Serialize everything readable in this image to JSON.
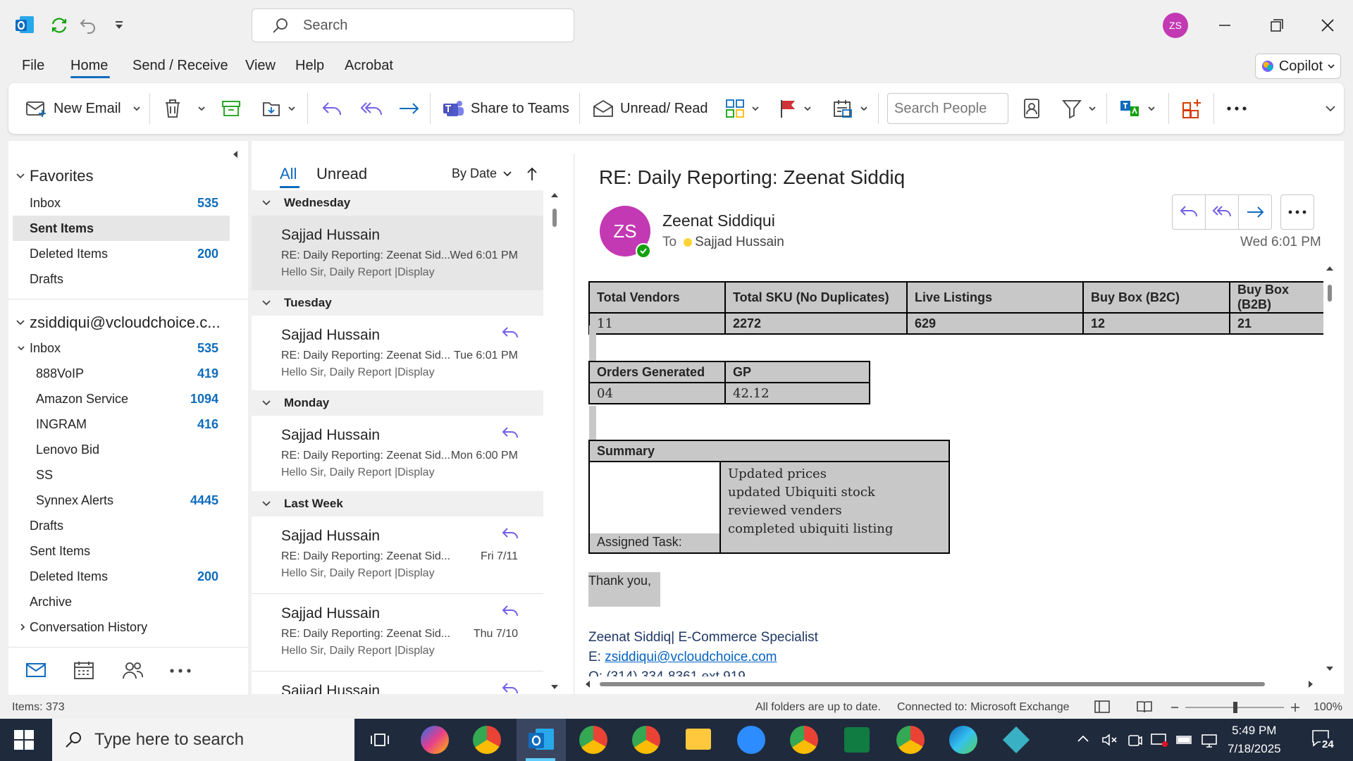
{
  "app": {
    "search_placeholder": "Search",
    "user_initials": "ZS"
  },
  "menu": [
    "File",
    "Home",
    "Send / Receive",
    "View",
    "Help",
    "Acrobat"
  ],
  "copilot_label": "Copilot",
  "ribbon": {
    "new_email": "New Email",
    "share_teams": "Share to Teams",
    "unread_read": "Unread/ Read",
    "search_people_placeholder": "Search People"
  },
  "folders": {
    "favorites_label": "Favorites",
    "favorites": [
      {
        "label": "Inbox",
        "count": "535"
      },
      {
        "label": "Sent Items",
        "count": ""
      },
      {
        "label": "Deleted Items",
        "count": "200"
      },
      {
        "label": "Drafts",
        "count": ""
      }
    ],
    "account_label": "zsiddiqui@vcloudchoice.c...",
    "inbox": {
      "label": "Inbox",
      "count": "535"
    },
    "inbox_children": [
      {
        "label": "888VoIP",
        "count": "419"
      },
      {
        "label": "Amazon Service",
        "count": "1094"
      },
      {
        "label": "INGRAM",
        "count": "416"
      },
      {
        "label": "Lenovo Bid",
        "count": ""
      },
      {
        "label": "SS",
        "count": ""
      },
      {
        "label": "Synnex Alerts",
        "count": "4445"
      }
    ],
    "account_other": [
      {
        "label": "Drafts",
        "count": ""
      },
      {
        "label": "Sent Items",
        "count": ""
      },
      {
        "label": "Deleted Items",
        "count": "200"
      },
      {
        "label": "Archive",
        "count": ""
      }
    ],
    "conversation_history": "Conversation History"
  },
  "list": {
    "tab_all": "All",
    "tab_unread": "Unread",
    "sort": "By Date",
    "groups": [
      "Wednesday",
      "Tuesday",
      "Monday",
      "Last Week"
    ],
    "messages": [
      {
        "from": "Sajjad Hussain",
        "subject": "RE: Daily Reporting: Zeenat Sid...",
        "preview": "Hello Sir,  Daily Report |Display",
        "date": "Wed 6:01 PM"
      },
      {
        "from": "Sajjad Hussain",
        "subject": "RE: Daily Reporting: Zeenat Sid...",
        "preview": "Hello Sir,  Daily Report |Display",
        "date": "Tue 6:01 PM"
      },
      {
        "from": "Sajjad Hussain",
        "subject": "RE: Daily Reporting: Zeenat Sid...",
        "preview": "Hello Sir,  Daily Report |Display",
        "date": "Mon 6:00 PM"
      },
      {
        "from": "Sajjad Hussain",
        "subject": "RE: Daily Reporting: Zeenat Sid...",
        "preview": "Hello Sir,  Daily Report |Display",
        "date": "Fri 7/11"
      },
      {
        "from": "Sajjad Hussain",
        "subject": "RE: Daily Reporting: Zeenat Sid...",
        "preview": "Hello Sir,  Daily Report |Display",
        "date": "Thu 7/10"
      },
      {
        "from": "Sajjad Hussain",
        "subject": "",
        "preview": "",
        "date": ""
      }
    ]
  },
  "reading": {
    "subject": "RE: Daily Reporting: Zeenat Siddiq",
    "avatar": "ZS",
    "sender": "Zeenat Siddiqui",
    "to_label": "To",
    "to_name": "Sajjad Hussain",
    "date": "Wed 6:01 PM",
    "table1": {
      "headers": [
        "Total Vendors",
        "Total SKU (No Duplicates)",
        "Live Listings",
        "Buy Box (B2C)",
        "Buy Box (B2B)"
      ],
      "values": [
        "11",
        "2272",
        "629",
        "12",
        "21"
      ]
    },
    "table2": {
      "headers": [
        "Orders Generated",
        "GP"
      ],
      "values": [
        "04",
        "42.12"
      ]
    },
    "summary": {
      "title": "Summary",
      "label": "Assigned Task:",
      "items": [
        "Updated prices",
        "updated Ubiquiti stock",
        "reviewed venders",
        "completed ubiquiti listing"
      ]
    },
    "thanks": "Thank you,",
    "signature": "Zeenat Siddiq| E-Commerce Specialist",
    "email_prefix": "E: ",
    "email": "zsiddiqui@vcloudchoice.com",
    "phone_partial": "O: (314) 334-8361 ext 919"
  },
  "status": {
    "items": "Items: 373",
    "sync": "All folders are up to date.",
    "connection": "Connected to: Microsoft Exchange",
    "zoom": "100%"
  },
  "taskbar": {
    "search_placeholder": "Type here to search",
    "time": "5:49 PM",
    "date": "7/18/2025",
    "notifications": "24"
  },
  "colors": {
    "accent": "#0f6cbd",
    "avatar": "#c239b3",
    "count": "#0f6cbd"
  }
}
